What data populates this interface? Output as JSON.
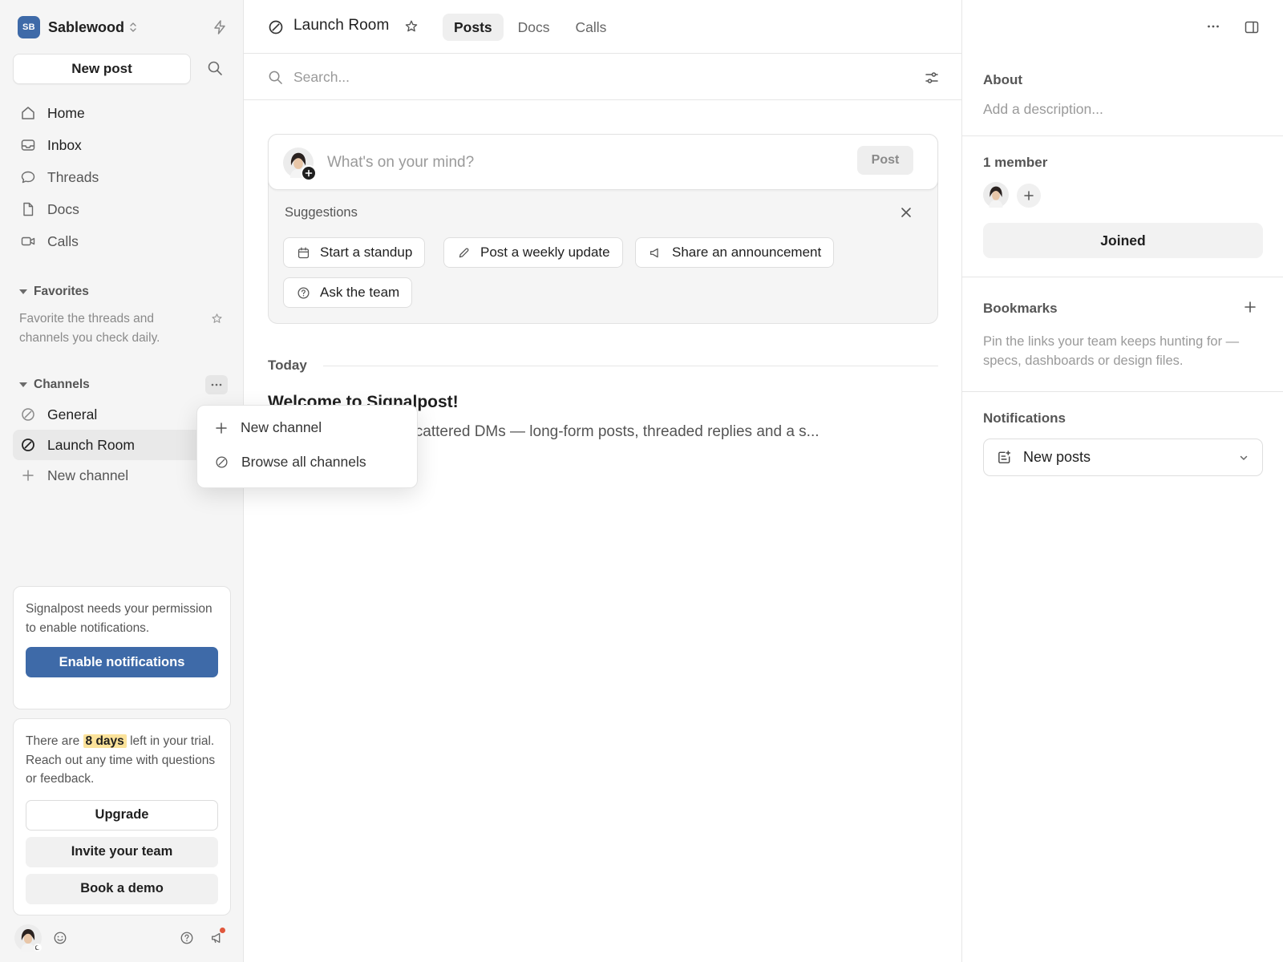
{
  "workspace": {
    "initials": "SB",
    "name": "Sablewood",
    "logo_color": "#3e6aa8"
  },
  "sidebar": {
    "new_post_label": "New post",
    "nav": [
      {
        "label": "Home",
        "icon": "home-icon"
      },
      {
        "label": "Inbox",
        "icon": "inbox-icon"
      },
      {
        "label": "Threads",
        "icon": "threads-icon"
      },
      {
        "label": "Docs",
        "icon": "doc-icon"
      },
      {
        "label": "Calls",
        "icon": "video-icon"
      }
    ],
    "favorites": {
      "heading": "Favorites",
      "hint": "Favorite the threads and channels you check daily."
    },
    "channels": {
      "heading": "Channels",
      "items": [
        {
          "label": "General",
          "icon": "channel-icon"
        },
        {
          "label": "Launch Room",
          "icon": "channel-icon",
          "active": true
        },
        {
          "label": "New channel",
          "icon": "plus-icon"
        }
      ]
    },
    "notif_card": {
      "text": "Signalpost needs your permission to enable notifications.",
      "button": "Enable notifications"
    },
    "trial_card": {
      "text_before": "There are",
      "highlight": "8 days",
      "text_after": "left in your trial. Reach out any time with questions or feedback.",
      "upgrade": "Upgrade",
      "invite": "Invite your team",
      "demo": "Book a demo"
    }
  },
  "header": {
    "room_title": "Launch Room",
    "tabs": [
      {
        "label": "Posts",
        "active": true
      },
      {
        "label": "Docs"
      },
      {
        "label": "Calls"
      }
    ]
  },
  "search": {
    "placeholder": "Search..."
  },
  "composer": {
    "placeholder": "What's on your mind?",
    "post_button": "Post",
    "suggestions_label": "Suggestions",
    "chips": [
      {
        "label": "Start a standup",
        "icon": "calendar-icon"
      },
      {
        "label": "Post a weekly update",
        "icon": "pencil-icon"
      },
      {
        "label": "Share an announcement",
        "icon": "megaphone-icon"
      },
      {
        "label": "Ask the team",
        "icon": "question-icon"
      }
    ]
  },
  "feed": {
    "day_label": "Today",
    "welcome_title": "Welcome to Signalpost!",
    "welcome_body": "Pull decisions out of scattered DMs — long-form posts, threaded replies and a s..."
  },
  "channel_menu": {
    "items": [
      {
        "label": "New channel",
        "icon": "plus-icon"
      },
      {
        "label": "Browse all channels",
        "icon": "channel-icon"
      }
    ]
  },
  "right_panel": {
    "about": {
      "heading": "About",
      "placeholder": "Add a description..."
    },
    "members": {
      "heading": "1 member",
      "joined_label": "Joined"
    },
    "bookmarks": {
      "heading": "Bookmarks",
      "hint": "Pin the links your team keeps hunting for — specs, dashboards or design files."
    },
    "notifications": {
      "heading": "Notifications",
      "selected": "New posts"
    }
  },
  "colors": {
    "accent": "#3e6aa8",
    "highlight": "#fbe29a",
    "notification_dot": "#e0573c"
  }
}
